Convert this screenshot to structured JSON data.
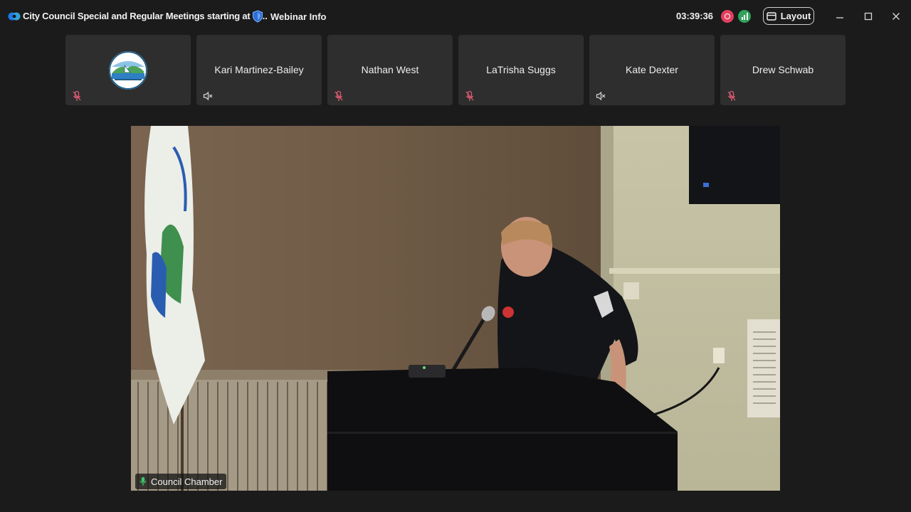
{
  "window": {
    "title": "City Council Special and Regular Meetings starting at 5 ...",
    "webinar_info_label": "Webinar Info",
    "timer": "03:39:36",
    "layout_label": "Layout"
  },
  "participants": [
    {
      "name": "",
      "mic": "muted-red",
      "avatar": true
    },
    {
      "name": "Kari Martinez-Bailey",
      "mic": "speaker-off"
    },
    {
      "name": "Nathan West",
      "mic": "muted-red"
    },
    {
      "name": "LaTrisha Suggs",
      "mic": "muted-red"
    },
    {
      "name": "Kate Dexter",
      "mic": "speaker-off"
    },
    {
      "name": "Drew Schwab",
      "mic": "muted-red"
    }
  ],
  "main_video": {
    "label": "Council Chamber",
    "mic": "active-green"
  },
  "colors": {
    "background": "#1b1b1b",
    "tile": "#2e2e2e",
    "muted_red": "#e35b73",
    "record": "#e0405e",
    "stats": "#2fa35a",
    "active_mic": "#3fc86c"
  }
}
